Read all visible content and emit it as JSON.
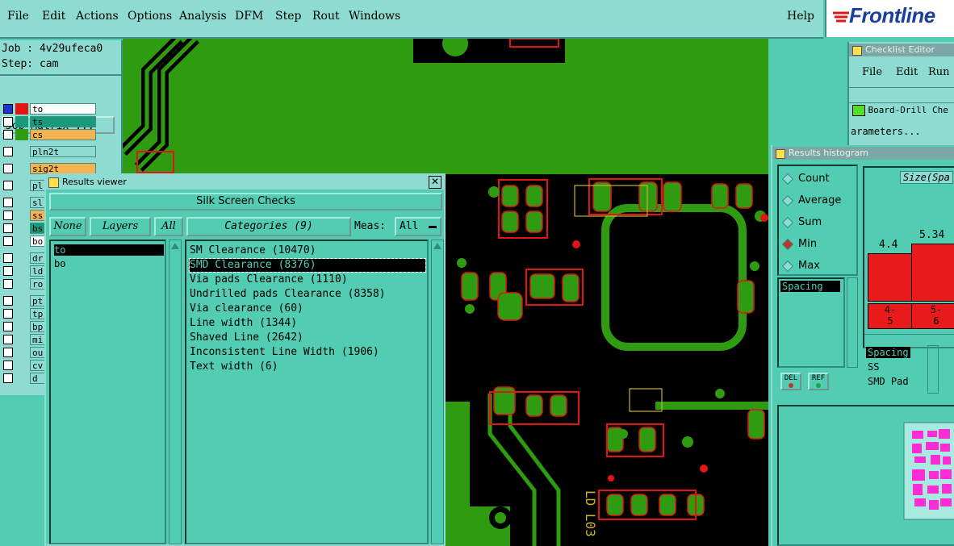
{
  "menubar": {
    "items": [
      "File",
      "Edit",
      "Actions",
      "Options",
      "Analysis",
      "DFM",
      "Step",
      "Rout",
      "Windows"
    ],
    "help": "Help",
    "logo": "Frontline"
  },
  "job_panel": {
    "job": "Job : 4v29ufeca0",
    "step": "Step: cam",
    "job_matrix": "Job Matrix ...",
    "layers": [
      {
        "name": "to",
        "color": "#ffffff",
        "swatch": "#e31414",
        "checked": true
      },
      {
        "name": "ts",
        "color": "#1b9a7a",
        "swatch": "#1b9a7a",
        "checked": false
      },
      {
        "name": "cs",
        "color": "#f5b250",
        "swatch": "#2e9b10",
        "checked": false
      },
      {
        "name": "pln2t",
        "color": "#8edcd1",
        "swatch": "#8edcd1",
        "checked": false
      },
      {
        "name": "sig2t",
        "color": "#f5b250",
        "swatch": "#8edcd1",
        "checked": false
      },
      {
        "name": "pl",
        "color": "#8edcd1",
        "swatch": "#8edcd1",
        "checked": false
      },
      {
        "name": "sl",
        "color": "#8edcd1",
        "swatch": "#8edcd1",
        "checked": false
      },
      {
        "name": "ss",
        "color": "#f5b250",
        "swatch": "#8edcd1",
        "checked": false
      },
      {
        "name": "bs",
        "color": "#1b9a7a",
        "swatch": "#8edcd1",
        "checked": false
      },
      {
        "name": "bo",
        "color": "#ffffff",
        "swatch": "#8edcd1",
        "checked": false
      },
      {
        "name": "dr",
        "color": "#8edcd1",
        "swatch": "#8edcd1",
        "checked": false
      },
      {
        "name": "ld",
        "color": "#8edcd1",
        "swatch": "#8edcd1",
        "checked": false
      },
      {
        "name": "ro",
        "color": "#8edcd1",
        "swatch": "#8edcd1",
        "checked": false
      },
      {
        "name": "pt",
        "color": "#8edcd1",
        "swatch": "#8edcd1",
        "checked": false
      },
      {
        "name": "tp",
        "color": "#8edcd1",
        "swatch": "#8edcd1",
        "checked": false
      },
      {
        "name": "bp",
        "color": "#8edcd1",
        "swatch": "#8edcd1",
        "checked": false
      },
      {
        "name": "mi",
        "color": "#8edcd1",
        "swatch": "#8edcd1",
        "checked": false
      },
      {
        "name": "ou",
        "color": "#8edcd1",
        "swatch": "#8edcd1",
        "checked": false
      },
      {
        "name": "cv",
        "color": "#8edcd1",
        "swatch": "#8edcd1",
        "checked": false
      },
      {
        "name": "d",
        "color": "#8edcd1",
        "swatch": "#8edcd1",
        "checked": false
      }
    ]
  },
  "results_viewer": {
    "title": "Results viewer",
    "header": "Silk Screen Checks",
    "none_btn": "None",
    "layers_btn": "Layers",
    "all_btn": "All",
    "categories_btn": "Categories (9)",
    "meas_label": "Meas:",
    "meas_value": "All",
    "layer_items": [
      "to",
      "bo"
    ],
    "categories": [
      "SM Clearance (10470)",
      "SMD Clearance (8376)",
      "Via pads Clearance (1110)",
      "Undrilled pads Clearance (8358)",
      "Via clearance (60)",
      "Line width (1344)",
      "Shaved Line (2642)",
      "Inconsistent Line Width (1906)",
      "Text width (6)"
    ]
  },
  "checklist_editor": {
    "title": "Checklist Editor",
    "menu": [
      "File",
      "Edit",
      "Run"
    ],
    "row": "Board-Drill Che",
    "params": "arameters..."
  },
  "histogram": {
    "title": "Results histogram",
    "modes": [
      "Count",
      "Average",
      "Sum",
      "Min",
      "Max"
    ],
    "selected_mode": "Min",
    "chart_label": "Size(Spa",
    "bars": [
      {
        "value": "4.4",
        "range": "4-\n5"
      },
      {
        "value": "5.34",
        "range": "5-\n6"
      }
    ],
    "list_left": [
      "Spacing"
    ],
    "list_right": [
      "Spacing",
      "SS",
      "SMD Pad"
    ],
    "del_btn": "DEL",
    "ref_btn": "REF"
  },
  "canvas": {
    "silk_text": "LD L03"
  },
  "colors": {
    "panel": "#8edcd1",
    "bg": "#53cdb1",
    "copper": "#2e9b10",
    "highlight": "#e31414"
  }
}
